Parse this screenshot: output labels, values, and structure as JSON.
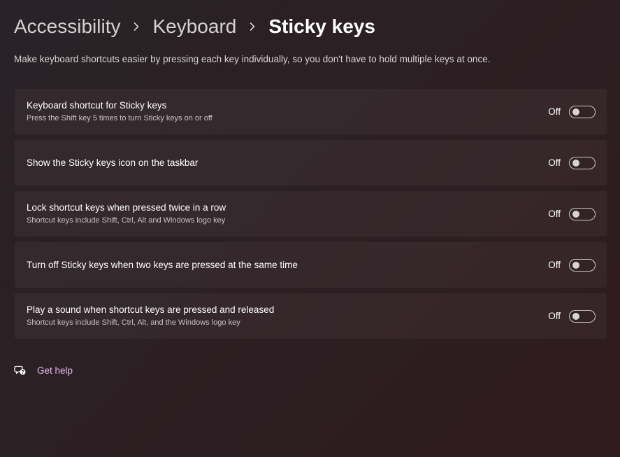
{
  "breadcrumb": {
    "items": [
      "Accessibility",
      "Keyboard"
    ],
    "current": "Sticky keys"
  },
  "description": "Make keyboard shortcuts easier by pressing each key individually, so you don't have to hold multiple keys at once.",
  "settings": [
    {
      "title": "Keyboard shortcut for Sticky keys",
      "subtitle": "Press the Shift key 5 times to turn Sticky keys on or off",
      "state": "Off",
      "on": false
    },
    {
      "title": "Show the Sticky keys icon on the taskbar",
      "subtitle": "",
      "state": "Off",
      "on": false
    },
    {
      "title": "Lock shortcut keys when pressed twice in a row",
      "subtitle": "Shortcut keys include Shift, Ctrl, Alt and Windows logo key",
      "state": "Off",
      "on": false
    },
    {
      "title": "Turn off Sticky keys when two keys are pressed at the same time",
      "subtitle": "",
      "state": "Off",
      "on": false
    },
    {
      "title": "Play a sound when shortcut keys are pressed and released",
      "subtitle": "Shortcut keys include Shift, Ctrl, Alt, and the Windows logo key",
      "state": "Off",
      "on": false
    }
  ],
  "help": {
    "label": "Get help",
    "icon": "help-chat-icon"
  },
  "colors": {
    "background": "#2b2024",
    "link": "#e6b8ef",
    "card": "rgba(255,255,255,0.045)"
  }
}
